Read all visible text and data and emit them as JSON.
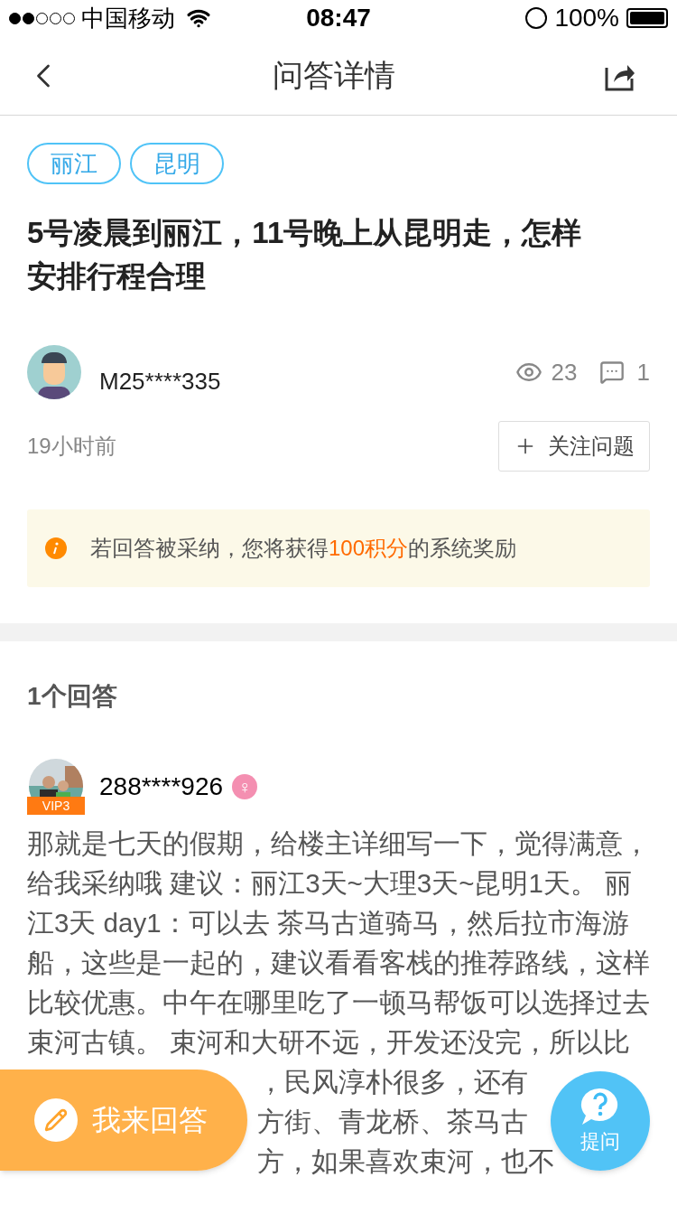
{
  "status_bar": {
    "carrier": "中国移动",
    "time": "08:47",
    "battery": "100%"
  },
  "nav": {
    "title": "问答详情"
  },
  "question": {
    "tags": [
      "丽江",
      "昆明"
    ],
    "title": "5号凌晨到丽江，11号晚上从昆明走，怎样安排行程合理",
    "author": "M25****335",
    "views": "23",
    "comments": "1",
    "time": "19小时前",
    "follow_button": "关注问题",
    "notice": "若回答被采纳，您将获得**100积分**的系统奖励"
  },
  "answers": {
    "heading": "1个回答",
    "items": [
      {
        "user": "288****926",
        "badge": "VIP3",
        "gender": "♀",
        "text": "那就是七天的假期，给楼主详细写一下，觉得满意，给我采纳哦 建议：丽江3天~大理3天~昆明1天。 丽江3天 day1：可以去 茶马古道骑马，然后拉市海游船，这些是一起的，建议看看客栈的推荐路线，这样比较优惠。中午在哪里吃了一顿马帮饭可以选择过去束河古镇。 束河和大研不远，开发还没完，所以比",
        "text_fragments": [
          "，民风淳朴很多，还有",
          "方街、青龙桥、茶马古",
          "方，如果喜欢束河，也不"
        ]
      }
    ]
  },
  "floating": {
    "answer_button": "我来回答",
    "ask_button": "提问"
  }
}
